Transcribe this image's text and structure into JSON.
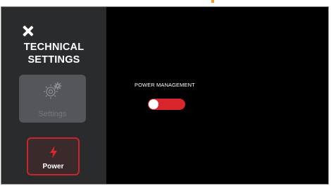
{
  "header": {
    "title_line1": "TECHNICAL",
    "title_line2": "SETTINGS"
  },
  "sidebar": {
    "items": [
      {
        "label": "Settings",
        "icon": "gear-icon",
        "state": "disabled"
      },
      {
        "label": "Power",
        "icon": "lightning-bolt-icon",
        "state": "selected"
      }
    ]
  },
  "main": {
    "section_label": "POWER MANAGEMENT",
    "toggle_state": "on"
  },
  "colors": {
    "accent": "#d8262c",
    "sidebar_bg": "#2a2b2d",
    "content_bg": "#000000"
  }
}
